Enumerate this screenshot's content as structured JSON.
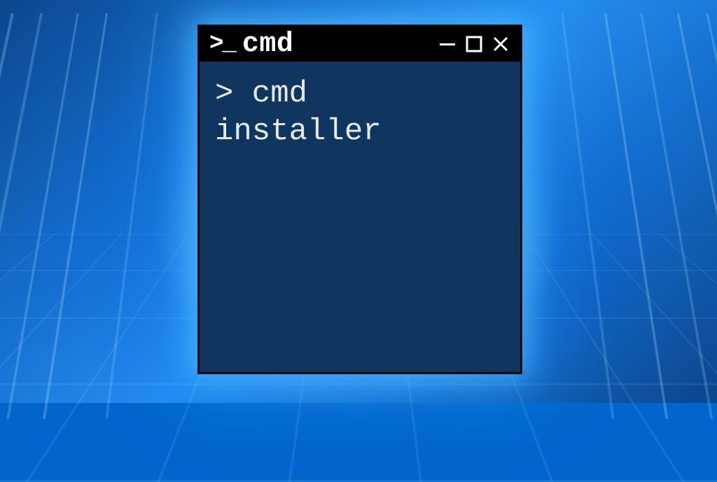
{
  "window": {
    "title_icon_text": ">_",
    "title": "cmd",
    "controls": {
      "minimize": "minimize",
      "maximize": "maximize",
      "close": "close"
    }
  },
  "terminal": {
    "prompt": ">",
    "command_line1": " cmd",
    "command_line2": "installer",
    "background_color": "#0f365f",
    "text_color": "#e8e8e8"
  }
}
